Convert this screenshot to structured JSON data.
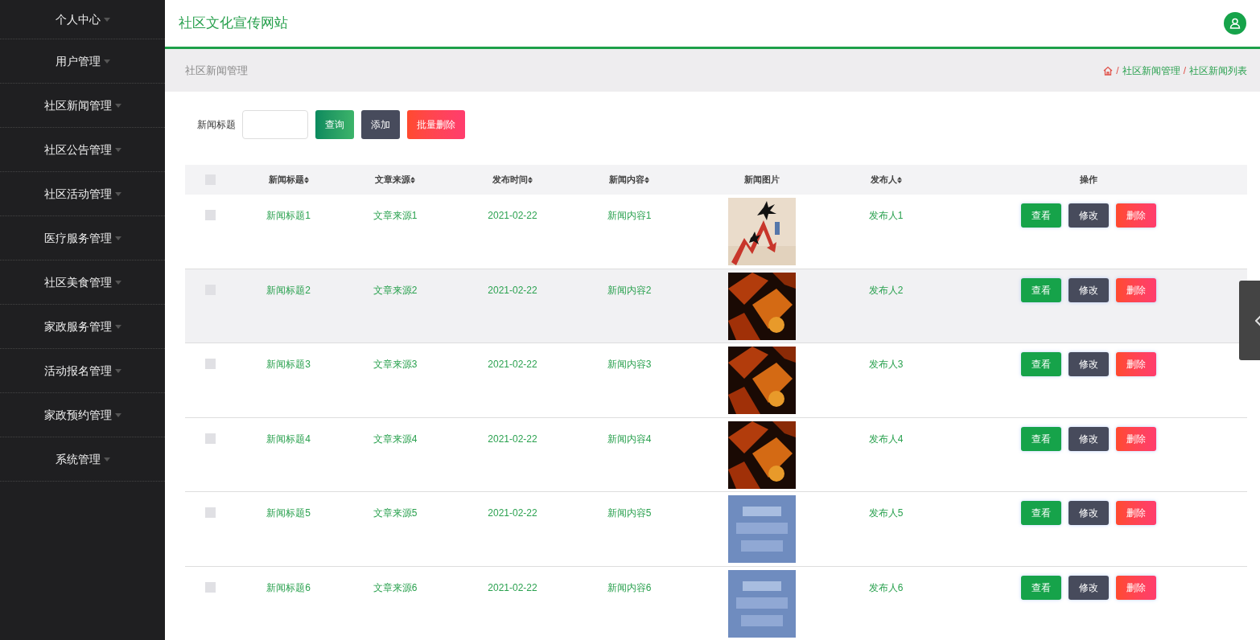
{
  "sidebar": {
    "items": [
      {
        "label": "个人中心",
        "selected": false
      },
      {
        "label": "用户管理",
        "selected": false
      },
      {
        "label": "社区新闻管理",
        "selected": false
      },
      {
        "label": "社区公告管理",
        "selected": false
      },
      {
        "label": "社区活动管理",
        "selected": false
      },
      {
        "label": "医疗服务管理",
        "selected": false
      },
      {
        "label": "社区美食管理",
        "selected": false
      },
      {
        "label": "家政服务管理",
        "selected": false
      },
      {
        "label": "活动报名管理",
        "selected": false
      },
      {
        "label": "家政预约管理",
        "selected": false
      },
      {
        "label": "系统管理",
        "selected": false
      }
    ]
  },
  "header": {
    "title": "社区文化宣传网站"
  },
  "page_bar": {
    "title": "社区新闻管理",
    "breadcrumb": [
      {
        "separator": "/",
        "label": "社区新闻管理"
      },
      {
        "separator": "/",
        "label": "社区新闻列表"
      }
    ]
  },
  "search": {
    "label": "新闻标题",
    "buttons": [
      {
        "label": "查询",
        "kind": "search"
      },
      {
        "label": "添加",
        "kind": "add"
      },
      {
        "label": "批量删除",
        "kind": "delete"
      }
    ]
  },
  "table": {
    "select_all_checked": false,
    "columns": [
      {
        "label": "新闻标题",
        "sortable": true
      },
      {
        "label": "文章来源",
        "sortable": true
      },
      {
        "label": "发布时间",
        "sortable": true
      },
      {
        "label": "新闻内容",
        "sortable": true
      },
      {
        "label": "新闻图片",
        "sortable": false
      },
      {
        "label": "发布人",
        "sortable": true
      },
      {
        "label": "操作",
        "sortable": false
      }
    ],
    "rows": [
      {
        "title": "新闻标题1",
        "source": "文章来源1",
        "date": "2021-02-22",
        "content": "新闻内容1",
        "publisher": "发布人1",
        "highlighted": false,
        "checked": false,
        "actions": [
          {
            "label": "查看",
            "kind": "view"
          },
          {
            "label": "修改",
            "kind": "edit"
          },
          {
            "label": "删除",
            "kind": "delete"
          }
        ]
      },
      {
        "title": "新闻标题2",
        "source": "文章来源2",
        "date": "2021-02-22",
        "content": "新闻内容2",
        "publisher": "发布人2",
        "highlighted": true,
        "checked": false,
        "actions": [
          {
            "label": "查看",
            "kind": "view"
          },
          {
            "label": "修改",
            "kind": "edit"
          },
          {
            "label": "删除",
            "kind": "delete"
          }
        ]
      },
      {
        "title": "新闻标题3",
        "source": "文章来源3",
        "date": "2021-02-22",
        "content": "新闻内容3",
        "publisher": "发布人3",
        "highlighted": false,
        "checked": false,
        "actions": [
          {
            "label": "查看",
            "kind": "view"
          },
          {
            "label": "修改",
            "kind": "edit"
          },
          {
            "label": "删除",
            "kind": "delete"
          }
        ]
      },
      {
        "title": "新闻标题4",
        "source": "文章来源4",
        "date": "2021-02-22",
        "content": "新闻内容4",
        "publisher": "发布人4",
        "highlighted": false,
        "checked": false,
        "actions": [
          {
            "label": "查看",
            "kind": "view"
          },
          {
            "label": "修改",
            "kind": "edit"
          },
          {
            "label": "删除",
            "kind": "delete"
          }
        ]
      },
      {
        "title": "新闻标题5",
        "source": "文章来源5",
        "date": "2021-02-22",
        "content": "新闻内容5",
        "publisher": "发布人5",
        "highlighted": false,
        "checked": false,
        "actions": [
          {
            "label": "查看",
            "kind": "view"
          },
          {
            "label": "修改",
            "kind": "edit"
          },
          {
            "label": "删除",
            "kind": "delete"
          }
        ]
      },
      {
        "title": "新闻标题6",
        "source": "文章来源6",
        "date": "2021-02-22",
        "content": "新闻内容6",
        "publisher": "发布人6",
        "highlighted": false,
        "checked": false,
        "actions": [
          {
            "label": "查看",
            "kind": "view"
          },
          {
            "label": "修改",
            "kind": "edit"
          },
          {
            "label": "删除",
            "kind": "delete"
          }
        ]
      }
    ]
  }
}
